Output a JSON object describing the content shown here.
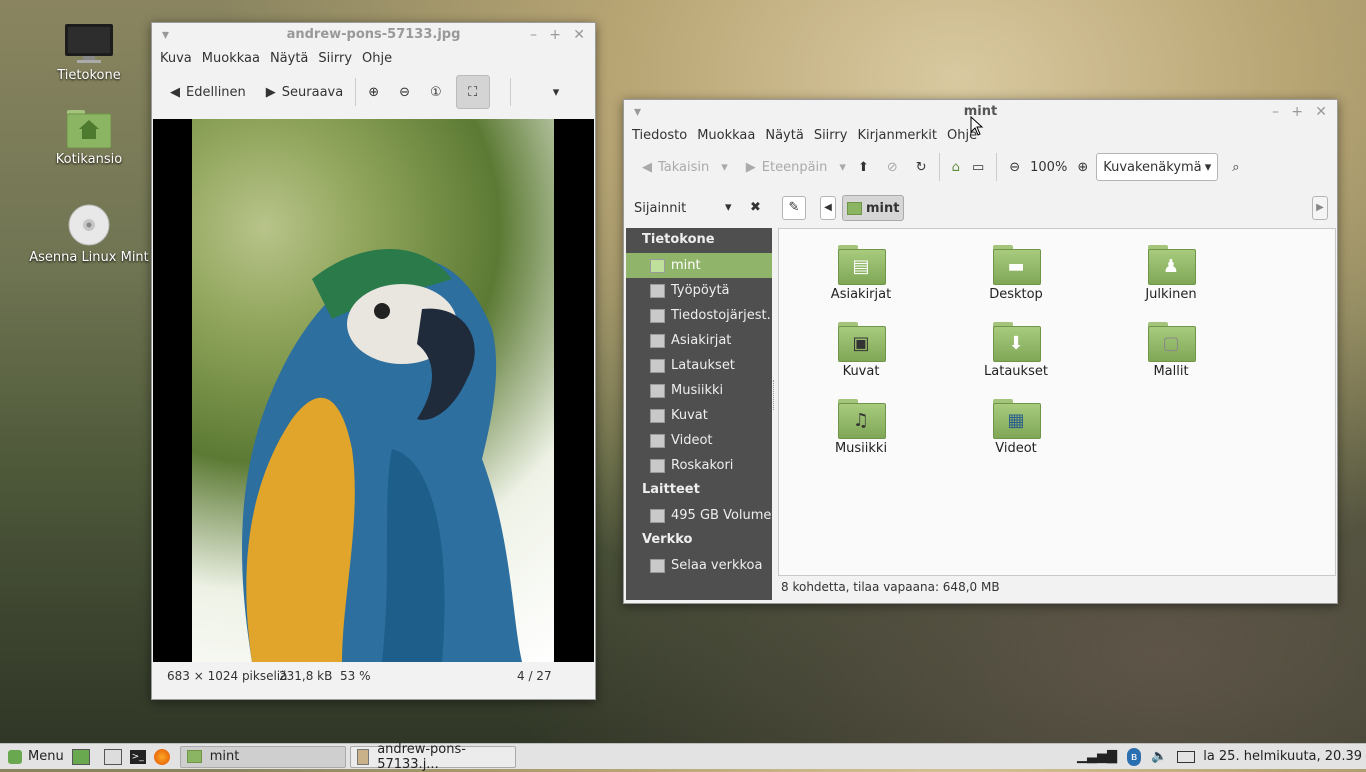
{
  "desktop": {
    "icons": [
      {
        "label": "Tietokone",
        "icon": "computer-icon"
      },
      {
        "label": "Kotikansio",
        "icon": "home-folder-icon"
      },
      {
        "label": "Asenna Linux Mint",
        "icon": "disc-icon"
      }
    ]
  },
  "viewer": {
    "title": "andrew-pons-57133.jpg",
    "menu": [
      "Kuva",
      "Muokkaa",
      "Näytä",
      "Siirry",
      "Ohje"
    ],
    "prev_label": "Edellinen",
    "next_label": "Seuraava",
    "status": {
      "dimensions": "683 × 1024 pikseliä",
      "size": "231,8 kB",
      "zoom": "53 %",
      "position": "4 / 27"
    }
  },
  "filemanager": {
    "title": "mint",
    "menu": [
      "Tiedosto",
      "Muokkaa",
      "Näytä",
      "Siirry",
      "Kirjanmerkit",
      "Ohje"
    ],
    "back_label": "Takaisin",
    "forward_label": "Eteenpäin",
    "zoom": "100%",
    "view_mode": "Kuvakenäkymä",
    "places_label": "Sijainnit",
    "path_current": "mint",
    "sidebar": {
      "sections": [
        {
          "heading": "Tietokone",
          "items": [
            "mint",
            "Työpöytä",
            "Tiedostojärjest...",
            "Asiakirjat",
            "Lataukset",
            "Musiikki",
            "Kuvat",
            "Videot",
            "Roskakori"
          ]
        },
        {
          "heading": "Laitteet",
          "items": [
            "495 GB Volume"
          ]
        },
        {
          "heading": "Verkko",
          "items": [
            "Selaa verkkoa"
          ]
        }
      ],
      "selected": "mint"
    },
    "files": [
      "Asiakirjat",
      "Desktop",
      "Julkinen",
      "Kuvat",
      "Lataukset",
      "Mallit",
      "Musiikki",
      "Videot"
    ],
    "statusbar": "8 kohdetta, tilaa vapaana: 648,0 MB"
  },
  "taskbar": {
    "menu_label": "Menu",
    "tasks": [
      "mint",
      "andrew-pons-57133.j..."
    ],
    "clock": "la 25. helmikuuta, 20.39"
  },
  "colors": {
    "mint_green": "#8fb46a",
    "sidebar_bg": "#4f4f4f"
  }
}
